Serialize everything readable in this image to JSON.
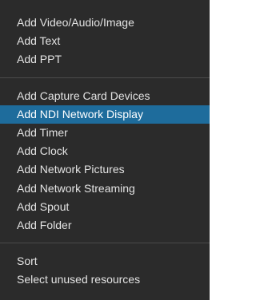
{
  "menu": {
    "groups": [
      {
        "items": [
          {
            "label": "Add Video/Audio/Image"
          },
          {
            "label": "Add Text"
          },
          {
            "label": "Add PPT"
          }
        ]
      },
      {
        "items": [
          {
            "label": "Add Capture Card Devices"
          },
          {
            "label": "Add NDI Network Display",
            "selected": true
          },
          {
            "label": "Add Timer"
          },
          {
            "label": "Add Clock"
          },
          {
            "label": "Add Network Pictures"
          },
          {
            "label": "Add Network Streaming"
          },
          {
            "label": "Add Spout"
          },
          {
            "label": "Add Folder"
          }
        ]
      },
      {
        "items": [
          {
            "label": "Sort"
          },
          {
            "label": "Select unused resources"
          }
        ]
      }
    ],
    "colors": {
      "background": "#2b2b2b",
      "text": "#e3e3e3",
      "highlight": "#1e6c9c",
      "separator": "#4a4a4a"
    }
  }
}
